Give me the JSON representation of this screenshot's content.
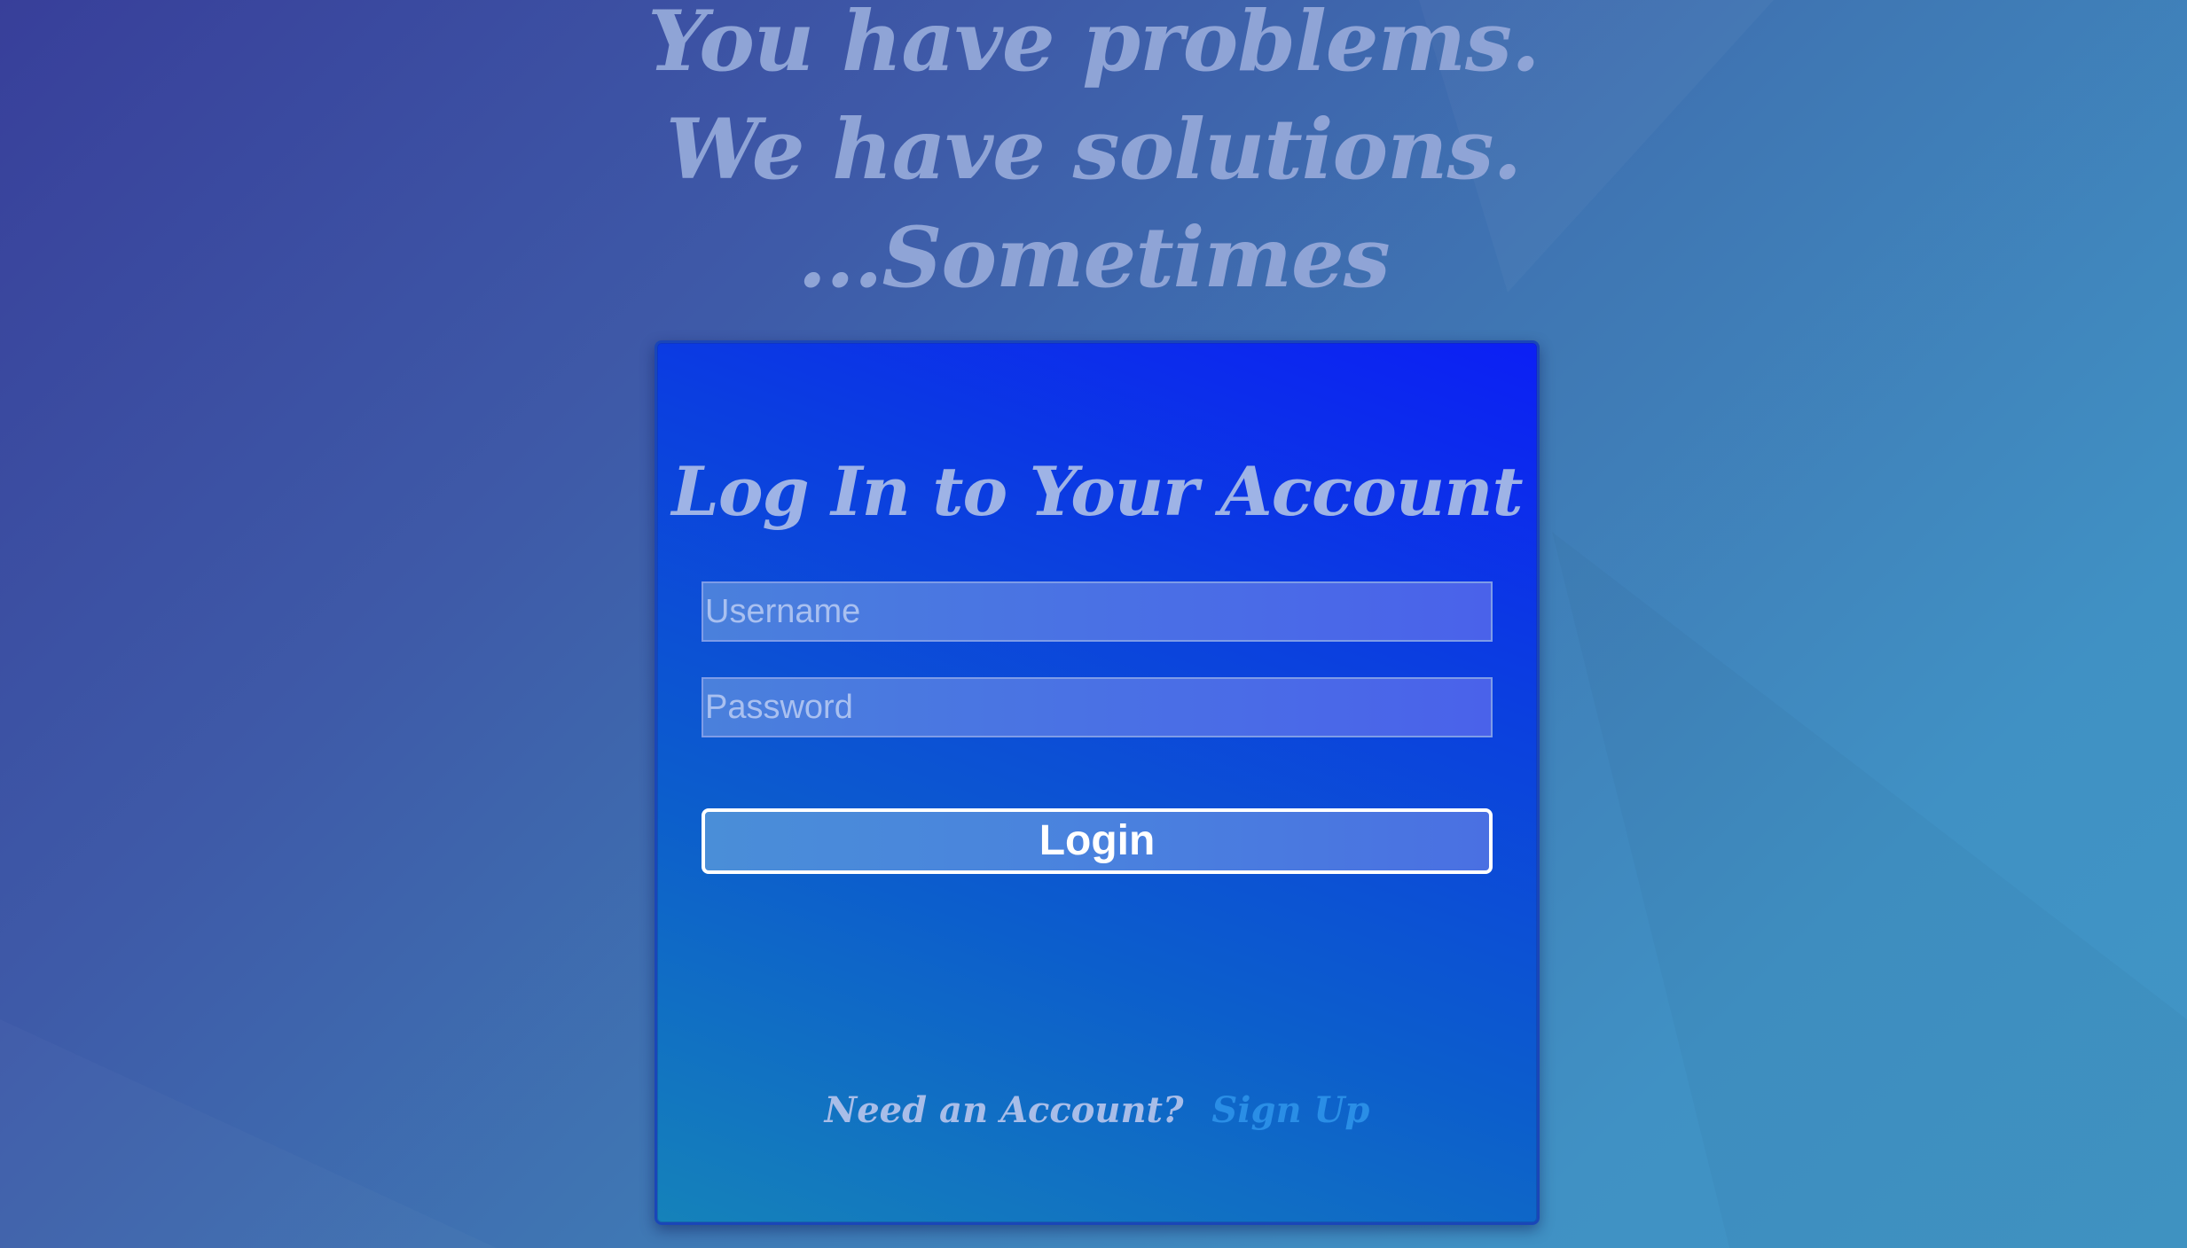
{
  "tagline": {
    "line1": "You have problems.",
    "line2": "We have solutions.",
    "line3": "...Sometimes"
  },
  "login_card": {
    "title": "Log In to Your Account",
    "username_placeholder": "Username",
    "password_placeholder": "Password",
    "login_label": "Login",
    "signup_prompt": "Need an Account?",
    "signup_link": "Sign Up"
  },
  "colors": {
    "background_start": "#383f9a",
    "background_end": "#4196c6",
    "card_top": "#0c1ff5",
    "card_bottom": "#1582ba",
    "heading_text": "#9eb3e6",
    "link": "#2a8ee6",
    "button_border": "#ffffff"
  }
}
